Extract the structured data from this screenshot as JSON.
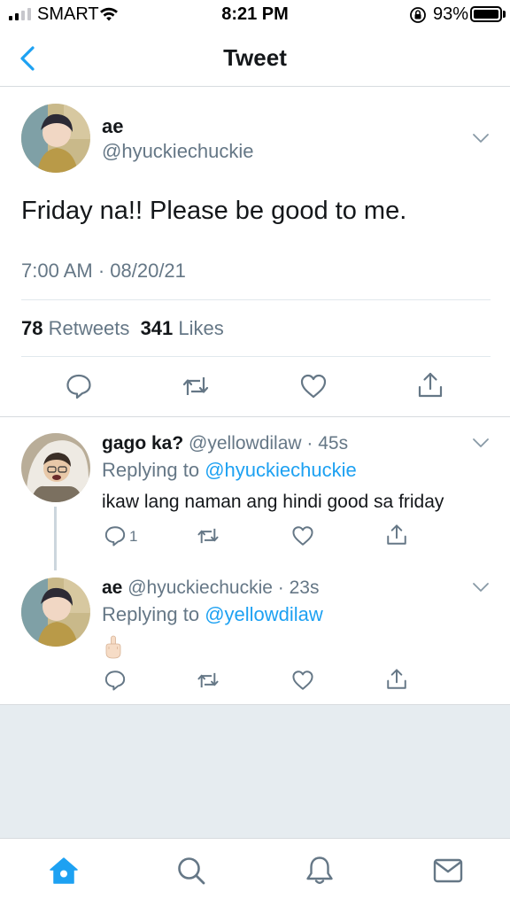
{
  "status_bar": {
    "carrier": "SMART",
    "time": "8:21 PM",
    "battery_percent": "93%",
    "battery_level": 0.93,
    "signal_bars": 2
  },
  "header": {
    "title": "Tweet",
    "back_icon": "chevron-left-icon"
  },
  "tweet": {
    "name": "ae",
    "handle": "@hyuckiechuckie",
    "text": "Friday na!! Please be good to me.",
    "timestamp": "7:00 AM · 08/20/21",
    "retweets_count": "78",
    "retweets_label": "Retweets",
    "likes_count": "341",
    "likes_label": "Likes"
  },
  "replies": [
    {
      "name": "gago ka?",
      "handle": "@yellowdilaw",
      "age": "· 45s",
      "replying_prefix": "Replying to",
      "replying_to": "@hyuckiechuckie",
      "text": "ikaw lang naman ang hindi good sa friday",
      "reply_count": "1"
    },
    {
      "name": "ae",
      "handle": "@hyuckiechuckie",
      "age": "· 23s",
      "replying_prefix": "Replying to",
      "replying_to": "@yellowdilaw",
      "text": ""
    }
  ],
  "colors": {
    "accent": "#1da1f2",
    "secondary_text": "#657786",
    "divider": "#e1e8ed",
    "empty_area": "#e6ecf0"
  },
  "tab_bar": {
    "icons": [
      "home-icon",
      "search-icon",
      "notifications-bell-icon",
      "messages-envelope-icon"
    ],
    "active": "home-icon"
  }
}
